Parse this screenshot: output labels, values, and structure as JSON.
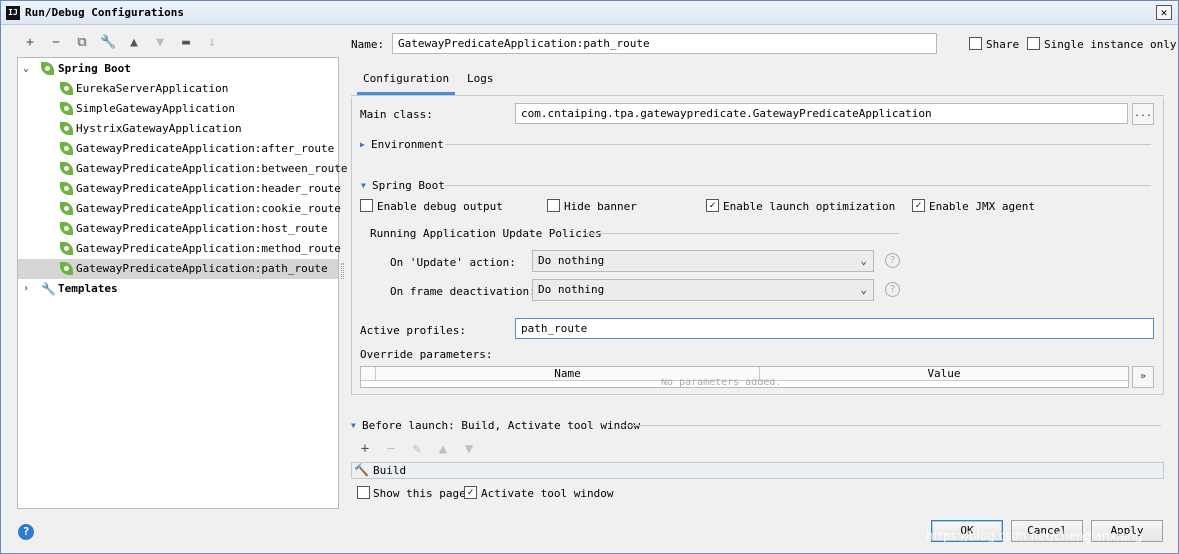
{
  "window": {
    "title": "Run/Debug Configurations",
    "app_icon": "IJ",
    "close_glyph": "✕"
  },
  "toolbar": {
    "icons": [
      "plus-icon",
      "minus-icon",
      "copy-icon",
      "wrench-icon",
      "arrow-up-icon",
      "arrow-down-icon",
      "folder-icon",
      "sort-icon"
    ]
  },
  "tree": {
    "group_spring_boot": "Spring Boot",
    "items": [
      "EurekaServerApplication",
      "SimpleGatewayApplication",
      "HystrixGatewayApplication",
      "GatewayPredicateApplication:after_route",
      "GatewayPredicateApplication:between_route",
      "GatewayPredicateApplication:header_route",
      "GatewayPredicateApplication:cookie_route",
      "GatewayPredicateApplication:host_route",
      "GatewayPredicateApplication:method_route",
      "GatewayPredicateApplication:path_route"
    ],
    "selected_index": 9,
    "group_templates": "Templates"
  },
  "name_field": {
    "label": "Name:",
    "value": "GatewayPredicateApplication:path_route"
  },
  "share": {
    "label": "Share",
    "checked": false
  },
  "single_instance": {
    "label": "Single instance only",
    "checked": false
  },
  "tabs": [
    {
      "label": "Configuration",
      "active": true
    },
    {
      "label": "Logs",
      "active": false
    }
  ],
  "config": {
    "main_class_label": "Main class:",
    "main_class_value": "com.cntaiping.tpa.gatewaypredicate.GatewayPredicateApplication",
    "browse_label": "...",
    "environment_label": "Environment",
    "spring_boot_label": "Spring Boot",
    "checkboxes": [
      {
        "label": "Enable debug output",
        "checked": false
      },
      {
        "label": "Hide banner",
        "checked": false
      },
      {
        "label": "Enable launch optimization",
        "checked": true
      },
      {
        "label": "Enable JMX agent",
        "checked": true
      }
    ],
    "update_policies_label": "Running Application Update Policies",
    "on_update_label": "On 'Update' action:",
    "on_update_value": "Do nothing",
    "on_frame_label": "On frame deactivation:",
    "on_frame_value": "Do nothing",
    "help_glyph": "?",
    "active_profiles_label": "Active profiles:",
    "active_profiles_value": "path_route",
    "override_label": "Override parameters:",
    "table_columns": [
      "Name",
      "Value"
    ],
    "table_empty": "No parameters added.",
    "table_expand": "»"
  },
  "before_launch": {
    "label": "Before launch: Build, Activate tool window",
    "icons": [
      "plus-icon",
      "minus-icon",
      "pencil-icon",
      "arrow-up-icon",
      "arrow-down-icon"
    ],
    "tasks": [
      "Build"
    ],
    "show_page_label": "Show this page",
    "show_page_checked": false,
    "activate_label": "Activate tool window",
    "activate_checked": true
  },
  "buttons": {
    "ok": "OK",
    "cancel": "Cancel",
    "apply": "Apply",
    "help": "?"
  },
  "watermark": "https://blog.csdn.net/chenqianxiang",
  "colors": {
    "accent": "#4a8ed6",
    "spring_green": "#6db33f",
    "selection": "#d5d5d5"
  }
}
